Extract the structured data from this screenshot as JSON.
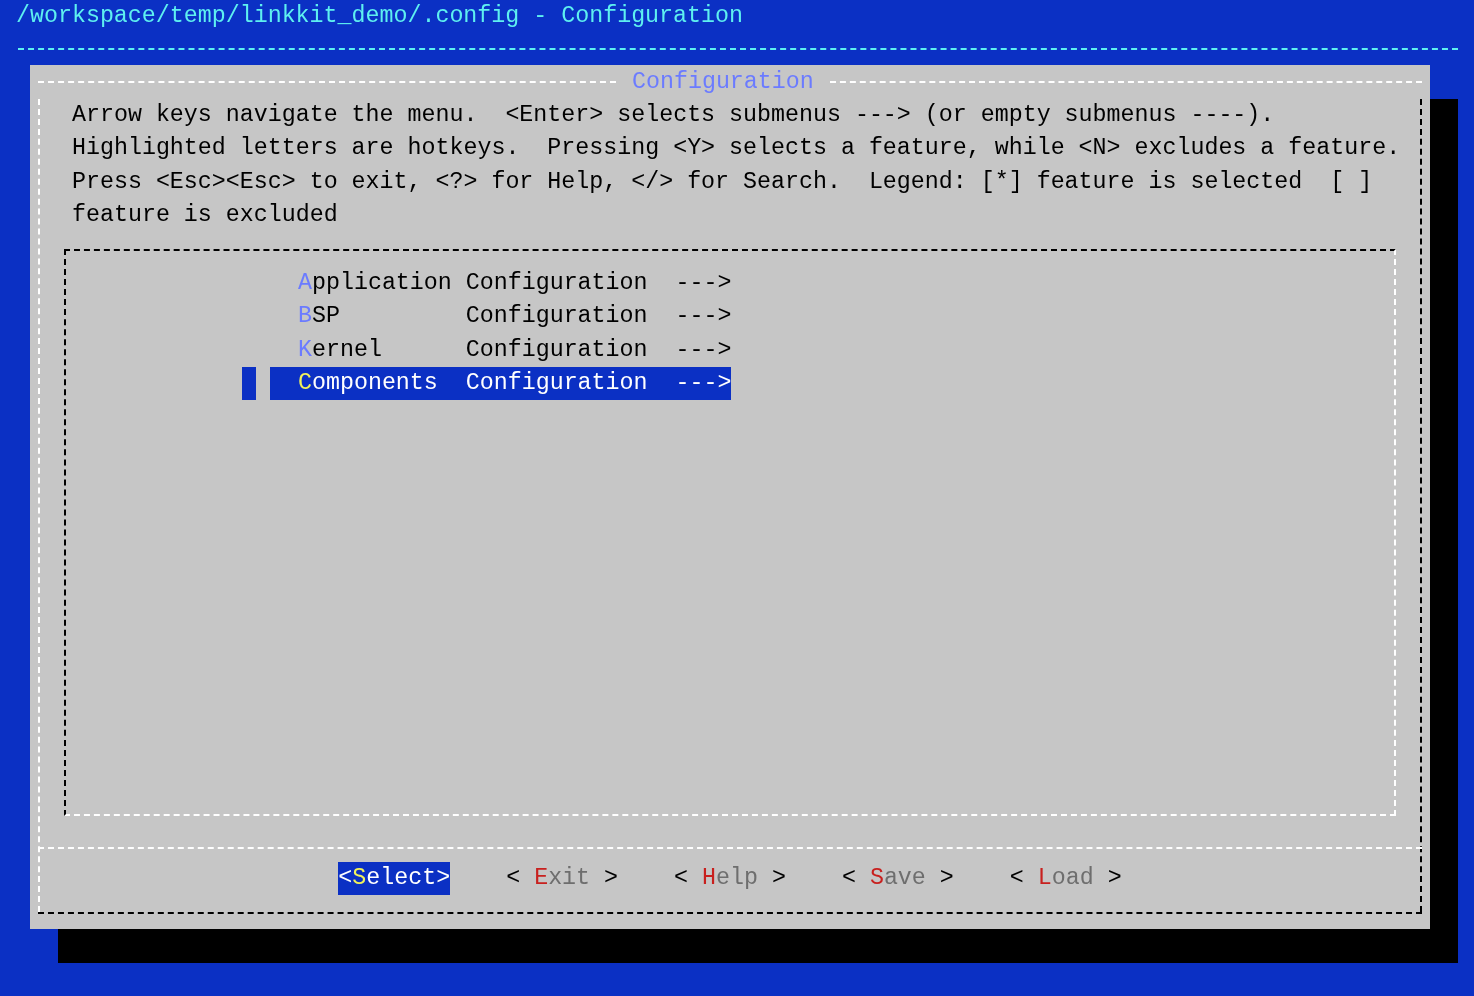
{
  "window": {
    "title": "/workspace/temp/linkkit_demo/.config - Configuration"
  },
  "dialog": {
    "title": "Configuration",
    "help_lines": [
      "Arrow keys navigate the menu.  <Enter> selects submenus ---> (or empty submenus ----).",
      "Highlighted letters are hotkeys.  Pressing <Y> selects a feature, while <N> excludes a feature.",
      "Press <Esc><Esc> to exit, <?> for Help, </> for Search.  Legend: [*] feature is selected  [ ]",
      "feature is excluded"
    ],
    "menu_items": [
      {
        "label": "Application Configuration  --->",
        "selected": false
      },
      {
        "label": "BSP         Configuration  --->",
        "selected": false
      },
      {
        "label": "Kernel      Configuration  --->",
        "selected": false
      },
      {
        "label": "Components  Configuration  --->",
        "selected": true
      }
    ],
    "buttons": [
      {
        "label": "<Select>",
        "selected": true
      },
      {
        "label": "< Exit >",
        "selected": false
      },
      {
        "label": "< Help >",
        "selected": false
      },
      {
        "label": "< Save >",
        "selected": false
      },
      {
        "label": "< Load >",
        "selected": false
      }
    ]
  }
}
